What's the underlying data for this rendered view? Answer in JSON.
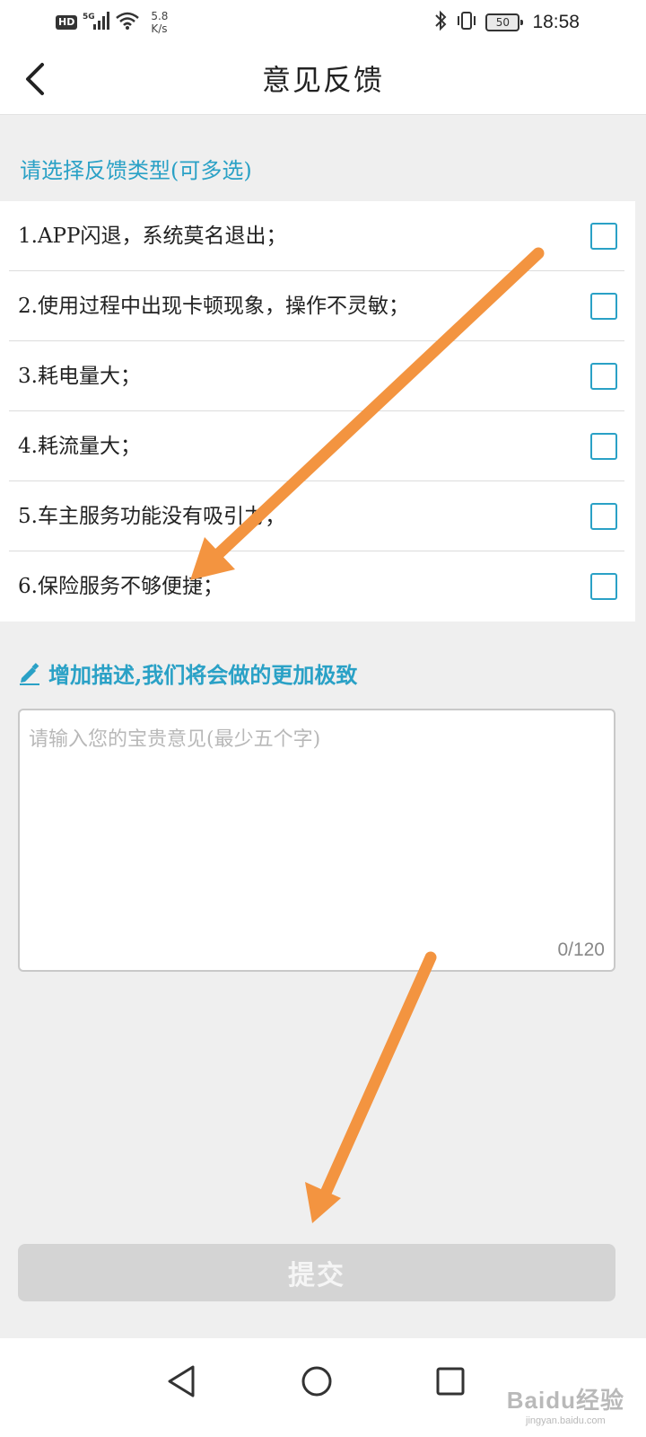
{
  "status_bar": {
    "hd_label": "HD",
    "signal_label": "5G",
    "net_speed_value": "5.8",
    "net_speed_unit": "K/s",
    "battery": "50",
    "time": "18:58"
  },
  "header": {
    "title": "意见反馈"
  },
  "feedback": {
    "section_label": "请选择反馈类型(可多选)",
    "options": [
      {
        "label": "1.APP闪退，系统莫名退出；",
        "checked": false
      },
      {
        "label": "2.使用过程中出现卡顿现象，操作不灵敏；",
        "checked": false
      },
      {
        "label": "3.耗电量大；",
        "checked": false
      },
      {
        "label": "4.耗流量大；",
        "checked": false
      },
      {
        "label": "5.车主服务功能没有吸引力；",
        "checked": false
      },
      {
        "label": "6.保险服务不够便捷；",
        "checked": false
      }
    ]
  },
  "description": {
    "label": "增加描述,我们将会做的更加极致",
    "placeholder": "请输入您的宝贵意见(最少五个字)",
    "value": "",
    "char_count": "0/120"
  },
  "submit": {
    "label": "提交"
  },
  "watermark": {
    "main": "Baidu经验",
    "sub": "jingyan.baidu.com"
  },
  "colors": {
    "accent": "#2aa1c6",
    "arrow": "#f39440",
    "submit_disabled": "#d4d4d4"
  }
}
